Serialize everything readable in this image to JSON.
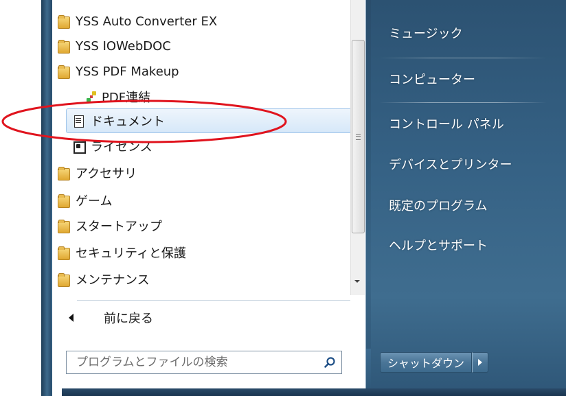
{
  "program_list": {
    "items": [
      {
        "label": "YSS Auto Converter EX",
        "icon": "folder-icon"
      },
      {
        "label": "YSS IOWebDOC",
        "icon": "folder-icon"
      },
      {
        "label": "YSS PDF Makeup",
        "icon": "folder-icon"
      },
      {
        "label": "PDF連結",
        "icon": "pdf-link-icon"
      },
      {
        "label": "ドキュメント",
        "icon": "document-icon"
      },
      {
        "label": "ライセンス",
        "icon": "license-icon"
      },
      {
        "label": "アクセサリ",
        "icon": "folder-icon"
      },
      {
        "label": "ゲーム",
        "icon": "folder-icon"
      },
      {
        "label": "スタートアップ",
        "icon": "folder-icon"
      },
      {
        "label": "セキュリティと保護",
        "icon": "folder-icon"
      },
      {
        "label": "メンテナンス",
        "icon": "folder-icon"
      }
    ],
    "selected_index": 4,
    "back_label": "前に戻る"
  },
  "search": {
    "placeholder": "プログラムとファイルの検索",
    "icon": "search-icon"
  },
  "right_panel": {
    "items": [
      {
        "label": "ミュージック"
      },
      {
        "label": "コンピューター"
      },
      {
        "label": "コントロール パネル"
      },
      {
        "label": "デバイスとプリンター"
      },
      {
        "label": "既定のプログラム"
      },
      {
        "label": "ヘルプとサポート"
      }
    ]
  },
  "shutdown": {
    "label": "シャットダウン",
    "arrow_icon": "chevron-right-icon"
  },
  "colors": {
    "highlight_ellipse": "#e0141e",
    "selection": "#d6e8f9",
    "panel_blue": "#356184"
  }
}
